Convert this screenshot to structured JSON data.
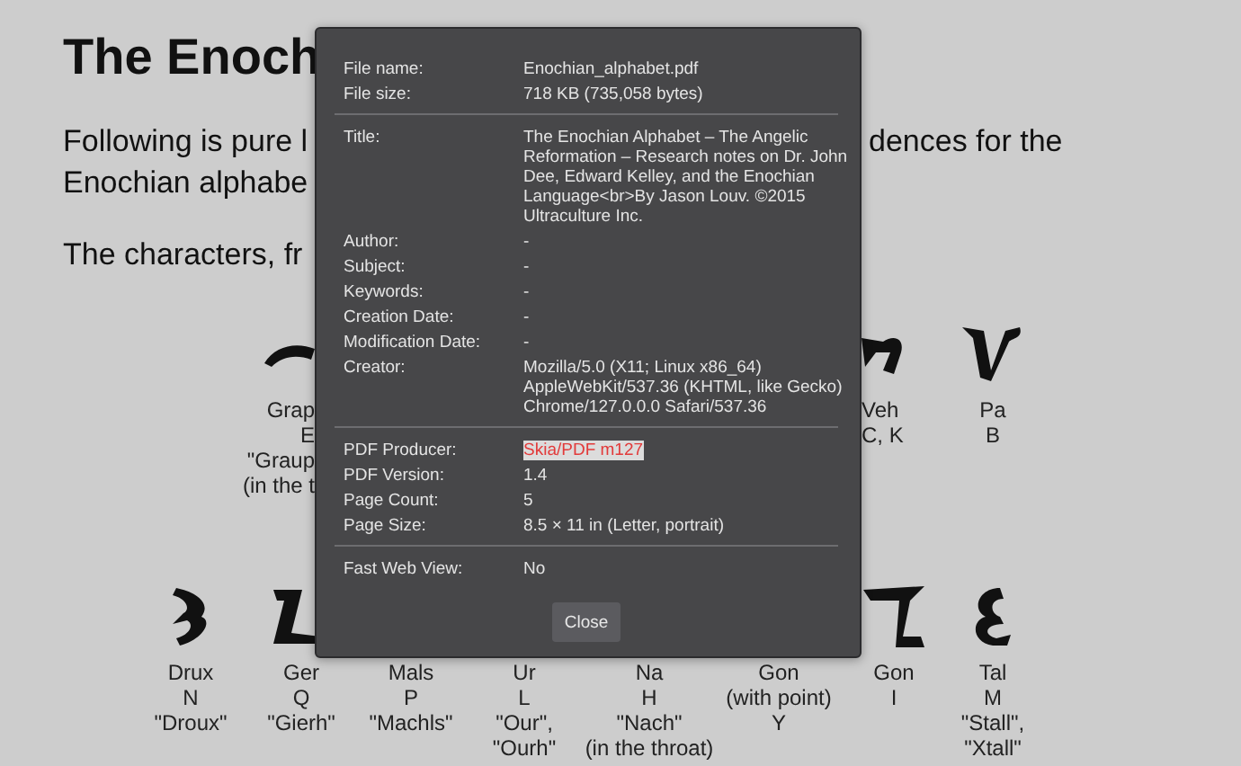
{
  "page": {
    "heading": "The Enoch",
    "lines": [
      {
        "text": "Following is pure l",
        "tail": "dences for the"
      },
      {
        "text": "Enochian alphabe"
      },
      {
        "text": "The characters, fr"
      }
    ],
    "glyph_rows": [
      [
        {
          "kind": "cut_right",
          "lines": [
            "Grap",
            "E",
            "\"Graup",
            "(in the t"
          ]
        },
        {
          "kind": "cut_left",
          "lines": [
            "Veh",
            "C, K"
          ]
        },
        {
          "kind": "whole",
          "lines": [
            "Pa",
            "B"
          ]
        }
      ],
      [
        {
          "kind": "whole",
          "lines": [
            "Drux",
            "N",
            "\"Droux\""
          ]
        },
        {
          "kind": "whole",
          "lines": [
            "Ger",
            "Q",
            "\"Gierh\""
          ]
        },
        {
          "kind": "whole",
          "lines": [
            "Mals",
            "P",
            "\"Machls\""
          ]
        },
        {
          "kind": "whole",
          "lines": [
            "Ur",
            "L",
            "\"Our\",",
            "\"Ourh\""
          ]
        },
        {
          "kind": "whole",
          "lines": [
            "Na",
            "H",
            "\"Nach\"",
            "(in the throat)"
          ]
        },
        {
          "kind": "whole",
          "lines": [
            "Gon",
            "(with point)",
            "Y"
          ]
        },
        {
          "kind": "whole",
          "lines": [
            "Gon",
            "I"
          ]
        },
        {
          "kind": "whole",
          "lines": [
            "Tal",
            "M",
            "\"Stall\",",
            "\"Xtall\""
          ]
        }
      ]
    ]
  },
  "dialog": {
    "sections": [
      [
        {
          "label": "File name:",
          "value": "Enochian_alphabet.pdf",
          "highlighted": false
        },
        {
          "label": "File size:",
          "value": "718 KB (735,058 bytes)",
          "highlighted": false
        }
      ],
      [
        {
          "label": "Title:",
          "value": "The Enochian Alphabet – The Angelic Reformation – Research notes on Dr. John Dee, Edward Kelley, and the Enochian Language<br>By Jason Louv. ©2015 Ultraculture Inc.",
          "highlighted": false
        },
        {
          "label": "Author:",
          "value": "-",
          "highlighted": false
        },
        {
          "label": "Subject:",
          "value": "-",
          "highlighted": false
        },
        {
          "label": "Keywords:",
          "value": "-",
          "highlighted": false
        },
        {
          "label": "Creation Date:",
          "value": "-",
          "highlighted": false
        },
        {
          "label": "Modification Date:",
          "value": "-",
          "highlighted": false
        },
        {
          "label": "Creator:",
          "value": "Mozilla/5.0 (X11; Linux x86_64) AppleWebKit/537.36 (KHTML, like Gecko) Chrome/127.0.0.0 Safari/537.36",
          "highlighted": false
        }
      ],
      [
        {
          "label": "PDF Producer:",
          "value": "Skia/PDF m127",
          "highlighted": true
        },
        {
          "label": "PDF Version:",
          "value": "1.4",
          "highlighted": false
        },
        {
          "label": "Page Count:",
          "value": "5",
          "highlighted": false
        },
        {
          "label": "Page Size:",
          "value": "8.5 × 11 in (Letter, portrait)",
          "highlighted": false
        }
      ],
      [
        {
          "label": "Fast Web View:",
          "value": "No",
          "highlighted": false
        }
      ]
    ],
    "close_button": "Close"
  }
}
